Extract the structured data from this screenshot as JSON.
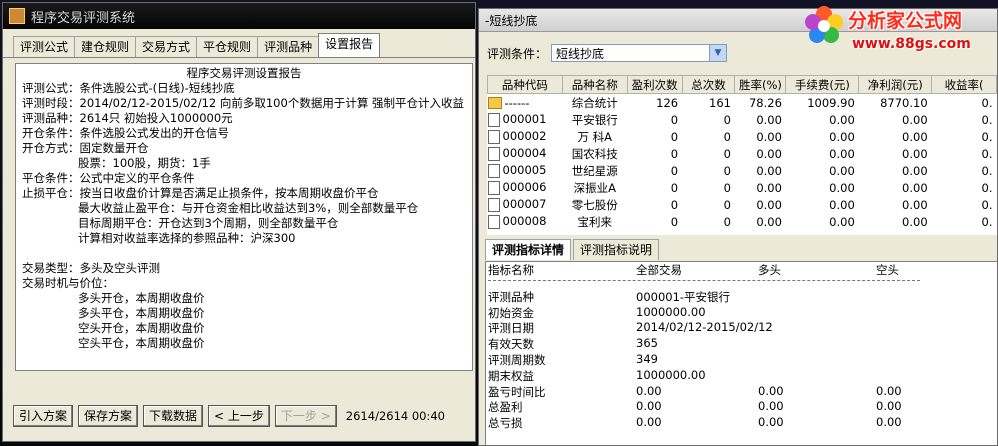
{
  "left_window": {
    "title": "程序交易评测系统",
    "tabs": [
      "评测公式",
      "建仓规则",
      "交易方式",
      "平仓规则",
      "评测品种",
      "设置报告"
    ],
    "active_tab": 5,
    "report": {
      "title": "程序交易评测设置报告",
      "lines": [
        "评测公式：条件选股公式-(日线)-短线抄底",
        "评测时段：2014/02/12-2015/02/12 向前多取100个数据用于计算 强制平仓计入收益",
        "评测品种：2614只 初始投入1000000元",
        "开仓条件：条件选股公式发出的开仓信号",
        "开仓方式：固定数量开仓",
        "股票：100股，期货：1手",
        "平仓条件：公式中定义的平仓条件",
        "止损平仓：按当日收盘价计算是否满足止损条件，按本周期收盘价平仓",
        "最大收益止盈平仓：与开仓资金相比收益达到3%，则全部数量平仓",
        "目标周期平仓：开仓达到3个周期，则全部数量平仓",
        "计算相对收益率选择的参照品种：沪深300",
        "",
        "交易类型：多头及空头评测",
        "交易时机与价位：",
        "多头开仓，本周期收盘价",
        "多头平仓，本周期收盘价",
        "空头开仓，本周期收盘价",
        "空头平仓，本周期收盘价"
      ]
    },
    "buttons": {
      "import": "引入方案",
      "save": "保存方案",
      "download": "下载数据",
      "prev": "< 上一步",
      "next": "下一步 >"
    },
    "progress_text": "2614/2614 00:40"
  },
  "right_window": {
    "title": "-短线抄底",
    "condition_label": "评测条件：",
    "condition_value": "短线抄底",
    "grid": {
      "columns": [
        "品种代码",
        "品种名称",
        "盈利次数",
        "总次数",
        "胜率(%)",
        "手续费(元)",
        "净利润(元)",
        "收益率("
      ],
      "rows": [
        [
          "------",
          "综合统计",
          "126",
          "161",
          "78.26",
          "1009.90",
          "8770.10",
          "0."
        ],
        [
          "000001",
          "平安银行",
          "0",
          "0",
          "0.00",
          "0.00",
          "0.00",
          "0."
        ],
        [
          "000002",
          "万  科A",
          "0",
          "0",
          "0.00",
          "0.00",
          "0.00",
          "0."
        ],
        [
          "000004",
          "国农科技",
          "0",
          "0",
          "0.00",
          "0.00",
          "0.00",
          "0."
        ],
        [
          "000005",
          "世纪星源",
          "0",
          "0",
          "0.00",
          "0.00",
          "0.00",
          "0."
        ],
        [
          "000006",
          "深振业A",
          "0",
          "0",
          "0.00",
          "0.00",
          "0.00",
          "0."
        ],
        [
          "000007",
          "零七股份",
          "0",
          "0",
          "0.00",
          "0.00",
          "0.00",
          "0."
        ],
        [
          "000008",
          "宝利来",
          "0",
          "0",
          "0.00",
          "0.00",
          "0.00",
          "0."
        ]
      ]
    },
    "detail_tabs": [
      "评测指标详情",
      "评测指标说明"
    ],
    "detail": {
      "headers": [
        "指标名称",
        "全部交易",
        "多头",
        "空头"
      ],
      "rows": [
        [
          "评测品种",
          "000001-平安银行",
          "",
          ""
        ],
        [
          "初始资金",
          "1000000.00",
          "",
          ""
        ],
        [
          "评测日期",
          "2014/02/12-2015/02/12",
          "",
          ""
        ],
        [
          "有效天数",
          "365",
          "",
          ""
        ],
        [
          "评测周期数",
          "349",
          "",
          ""
        ],
        [
          "期末权益",
          "1000000.00",
          "",
          ""
        ],
        [
          "盈亏时间比",
          "0.00",
          "0.00",
          "0.00"
        ],
        [
          "总盈利",
          "0.00",
          "0.00",
          "0.00"
        ],
        [
          "总亏损",
          "0.00",
          "0.00",
          "0.00"
        ]
      ]
    }
  },
  "logo": {
    "name": "分析家公式网",
    "url_text": "www.88gs.com"
  },
  "colors": {
    "logo_red": "#ff2a1a",
    "folder_yellow": "#f5c848",
    "window_face": "#ece9d8"
  }
}
